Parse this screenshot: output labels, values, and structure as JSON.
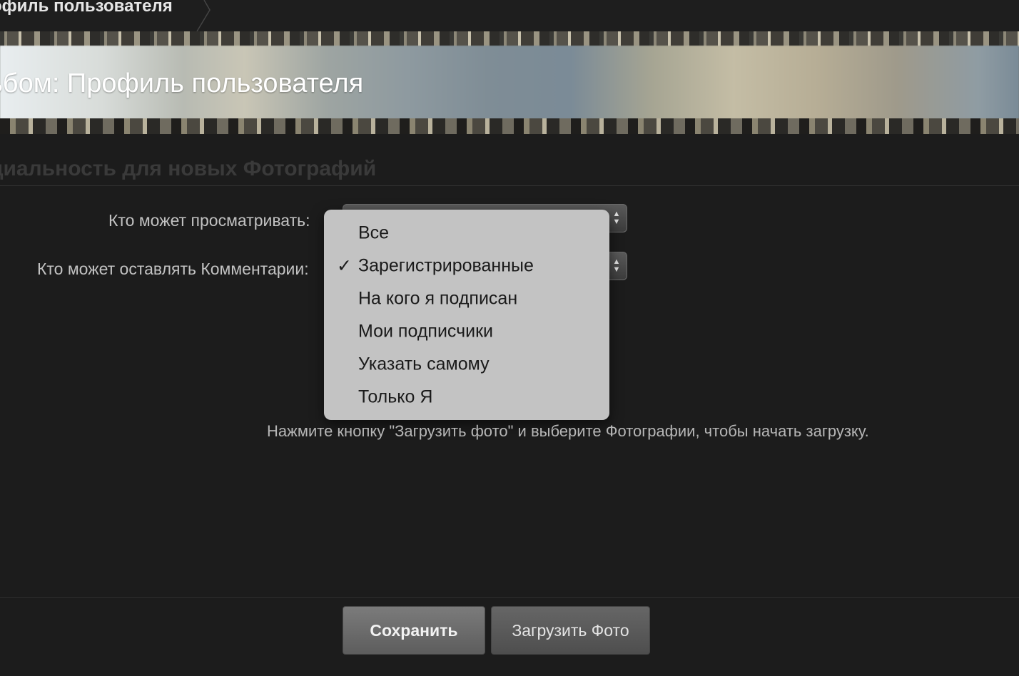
{
  "breadcrumb": {
    "current": "офиль пользователя"
  },
  "banner": {
    "title": "ьбом: Профиль пользователя"
  },
  "section": {
    "title": "циальность для новых Фотографий"
  },
  "form": {
    "view_label": "Кто может просматривать:",
    "comment_label": "Кто может оставлять Комментарии:"
  },
  "dropdown": {
    "selected_index": 1,
    "options": [
      "Все",
      "Зарегистрированные",
      "На кого я подписан",
      "Мои подписчики",
      "Указать самому",
      "Только Я"
    ]
  },
  "help": {
    "text": "Нажмите кнопку \"Загрузить фото\" и выберите Фотографии, чтобы начать загрузку."
  },
  "buttons": {
    "save": "Сохранить",
    "upload": "Загрузить Фото"
  },
  "icons": {
    "checkmark": "checkmark-icon",
    "select_arrows": "updown-arrows-icon",
    "breadcrumb_separator": "chevron-right-icon"
  },
  "colors": {
    "background": "#1c1c1c",
    "dropdown_bg": "#c3c3c3",
    "primary_button": "#6b6b6b"
  }
}
